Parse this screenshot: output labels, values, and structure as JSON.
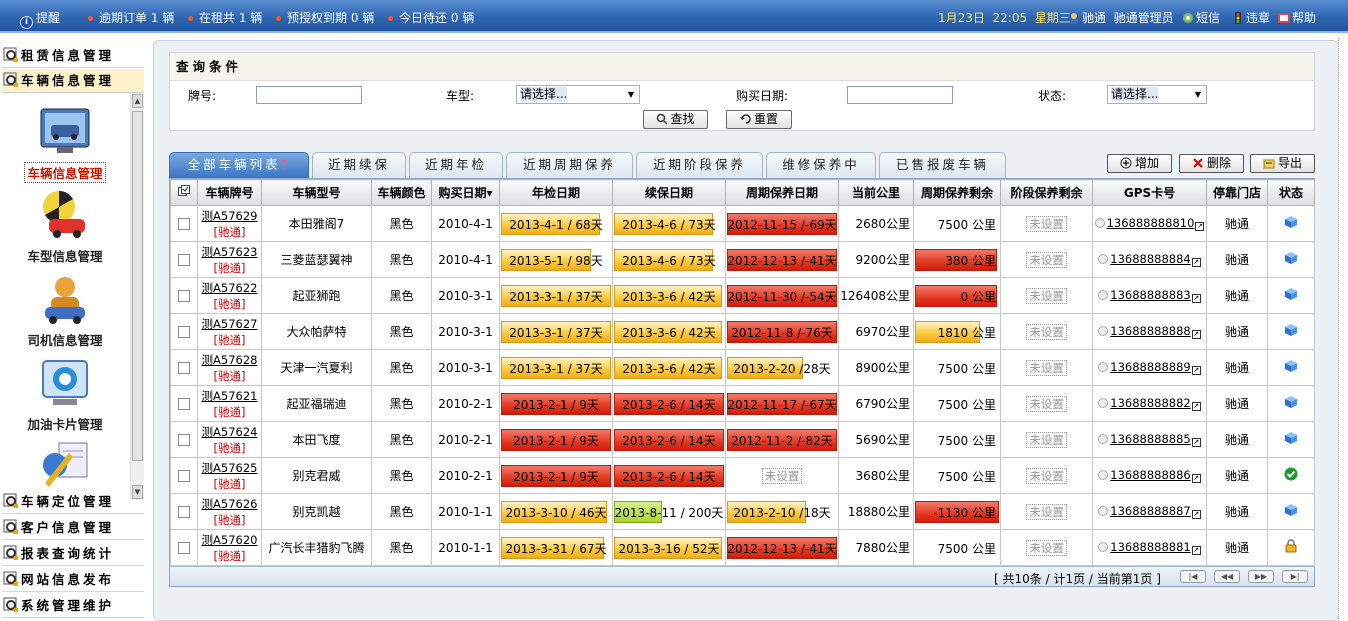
{
  "topbar": {
    "reminder": "提醒",
    "alerts": [
      "逾期订单 1 辆",
      "在租共 1 辆",
      "预授权到期 0 辆",
      "今日待还 0 辆"
    ],
    "date": "1月23日",
    "time": "22:05",
    "weekday": "星期三",
    "user": "驰通",
    "role": "驰通管理员",
    "sms": "短信",
    "violation": "违章",
    "help": "帮助"
  },
  "sidebar": {
    "menus_top": [
      "租赁信息管理",
      "车辆信息管理"
    ],
    "icon_items": [
      "车辆信息管理",
      "车型信息管理",
      "司机信息管理",
      "加油卡片管理"
    ],
    "menus_bottom": [
      "车辆定位管理",
      "客户信息管理",
      "报表查询统计",
      "网站信息发布",
      "系统管理维护"
    ]
  },
  "query": {
    "title": "查询条件",
    "plate_label": "牌号:",
    "model_label": "车型:",
    "model_value": "请选择...",
    "buydate_label": "购买日期:",
    "status_label": "状态:",
    "status_value": "请选择...",
    "search_btn": "查找",
    "reset_btn": "重置"
  },
  "tabs": {
    "all": "全部车辆列表",
    "all_q": "?",
    "items": [
      "近期续保",
      "近期年检",
      "近期周期保养",
      "近期阶段保养",
      "维修保养中",
      "已售报废车辆"
    ]
  },
  "actions": {
    "add": "增加",
    "delete": "删除",
    "export": "导出"
  },
  "table": {
    "headers": [
      "车辆牌号",
      "车辆型号",
      "车辆颜色",
      "购买日期▾",
      "年检日期",
      "续保日期",
      "周期保养日期",
      "当前公里",
      "周期保养剩余",
      "阶段保养剩余",
      "GPS卡号",
      "停靠门店",
      "状态"
    ],
    "rows": [
      {
        "plate": "测A57629",
        "store_tag": "[驰通]",
        "model": "本田雅阁7",
        "color": "黑色",
        "buy": "2010-4-1",
        "inspect": "2013-4-1 /  68天",
        "insure": "2013-4-6 /  73天",
        "maint": "2012-11-15 /-69天",
        "km": "2680公里",
        "cycle": "7500 公里",
        "stage": "未设置",
        "gps": "136888888810",
        "store": "驰通"
      },
      {
        "plate": "测A57623",
        "store_tag": "[驰通]",
        "model": "三菱蓝瑟翼神",
        "color": "黑色",
        "buy": "2010-4-1",
        "inspect": "2013-5-1 /  98天",
        "insure": "2013-4-6 /  73天",
        "maint": "2012-12-13 /-41天",
        "km": "9200公里",
        "cycle": "380 公里",
        "stage": "未设置",
        "gps": "13688888884",
        "store": "驰通"
      },
      {
        "plate": "测A57622",
        "store_tag": "[驰通]",
        "model": "起亚狮跑",
        "color": "黑色",
        "buy": "2010-3-1",
        "inspect": "2013-3-1 /  37天",
        "insure": "2013-3-6 /  42天",
        "maint": "2012-11-30 /-54天",
        "km": "126408公里",
        "cycle": "0 公里",
        "stage": "未设置",
        "gps": "13688888883",
        "store": "驰通"
      },
      {
        "plate": "测A57627",
        "store_tag": "[驰通]",
        "model": "大众帕萨特",
        "color": "黑色",
        "buy": "2010-3-1",
        "inspect": "2013-3-1 /  37天",
        "insure": "2013-3-6 /  42天",
        "maint": "2012-11-8 /-76天",
        "km": "6970公里",
        "cycle": "1810 公里",
        "stage": "未设置",
        "gps": "13688888888",
        "store": "驰通"
      },
      {
        "plate": "测A57628",
        "store_tag": "[驰通]",
        "model": "天津一汽夏利",
        "color": "黑色",
        "buy": "2010-3-1",
        "inspect": "2013-3-1 /  37天",
        "insure": "2013-3-6 /  42天",
        "maint": "2013-2-20 /28天",
        "km": "8900公里",
        "cycle": "7500 公里",
        "stage": "未设置",
        "gps": "13688888889",
        "store": "驰通"
      },
      {
        "plate": "测A57621",
        "store_tag": "[驰通]",
        "model": "起亚福瑞迪",
        "color": "黑色",
        "buy": "2010-2-1",
        "inspect": "2013-2-1 /  9天",
        "insure": "2013-2-6 /  14天",
        "maint": "2012-11-17 /-67天",
        "km": "6790公里",
        "cycle": "7500 公里",
        "stage": "未设置",
        "gps": "13688888882",
        "store": "驰通"
      },
      {
        "plate": "测A57624",
        "store_tag": "[驰通]",
        "model": "本田飞度",
        "color": "黑色",
        "buy": "2010-2-1",
        "inspect": "2013-2-1 /  9天",
        "insure": "2013-2-6 /  14天",
        "maint": "2012-11-2 /-82天",
        "km": "5690公里",
        "cycle": "7500 公里",
        "stage": "未设置",
        "gps": "13688888885",
        "store": "驰通"
      },
      {
        "plate": "测A57625",
        "store_tag": "[驰通]",
        "model": "别克君威",
        "color": "黑色",
        "buy": "2010-2-1",
        "inspect": "2013-2-1 /  9天",
        "insure": "2013-2-6 /  14天",
        "maint": "未设置",
        "km": "3680公里",
        "cycle": "7500 公里",
        "stage": "未设置",
        "gps": "13688888886",
        "store": "驰通"
      },
      {
        "plate": "测A57626",
        "store_tag": "[驰通]",
        "model": "别克凯越",
        "color": "黑色",
        "buy": "2010-1-1",
        "inspect": "2013-3-10 /  46天",
        "insure": "2013-8-11 / 200天",
        "maint": "2013-2-10 /18天",
        "km": "18880公里",
        "cycle": "-1130 公里",
        "stage": "未设置",
        "gps": "13688888887",
        "store": "驰通"
      },
      {
        "plate": "测A57620",
        "store_tag": "[驰通]",
        "model": "广汽长丰猎豹飞腾",
        "color": "黑色",
        "buy": "2010-1-1",
        "inspect": "2013-3-31 /  67天",
        "insure": "2013-3-16 /  52天",
        "maint": "2012-12-13 /-41天",
        "km": "7880公里",
        "cycle": "7500 公里",
        "stage": "未设置",
        "gps": "13688888881",
        "store": "驰通"
      }
    ]
  },
  "pager": {
    "info": "[ 共10条 / 计1页 / 当前第1页 ]"
  },
  "colors": {
    "accent": "#2f66b4",
    "bar_ok": "#f9c83a",
    "bar_overdue": "#e33922",
    "bar_long": "#a8d42f"
  }
}
